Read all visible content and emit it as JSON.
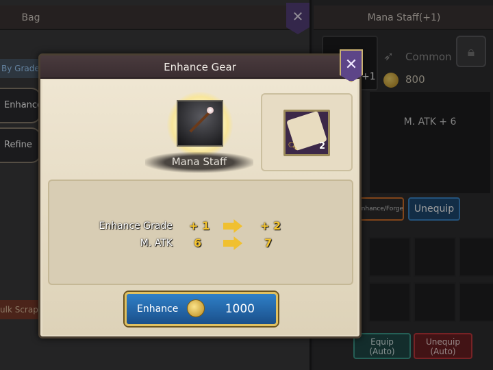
{
  "bag": {
    "title": "Bag",
    "filter_label": "By Grade",
    "tabs": [
      {
        "label": "Enhance"
      },
      {
        "label": "Refine"
      }
    ],
    "bulk_scrap_label": "ulk Scrap"
  },
  "item_panel": {
    "title": "Mana Staff(+1)",
    "slot_level": "+1",
    "rarity": "Common",
    "price": "800",
    "stat": "M. ATK + 6",
    "enhance_forge_label": "Enhance/Forge",
    "unequip_label": "Unequip",
    "equip_auto": {
      "line1": "Equip",
      "line2": "(Auto)"
    },
    "unequip_auto": {
      "line1": "Unequip",
      "line2": "(Auto)"
    }
  },
  "dialog": {
    "title": "Enhance Gear",
    "gear_name": "Mana Staff",
    "material_count": "2",
    "rows": [
      {
        "label": "Enhance Grade",
        "from": "+ 1",
        "to": "+ 2"
      },
      {
        "label": "M. ATK",
        "from": "6",
        "to": "7"
      }
    ],
    "enhance_button": {
      "label": "Enhance",
      "cost": "1000"
    }
  },
  "colors": {
    "accent_gold": "#f4c430",
    "dialog_bg": "#e6dcc6",
    "button_blue": "#2f80c8",
    "close_purple": "#5d4588"
  }
}
